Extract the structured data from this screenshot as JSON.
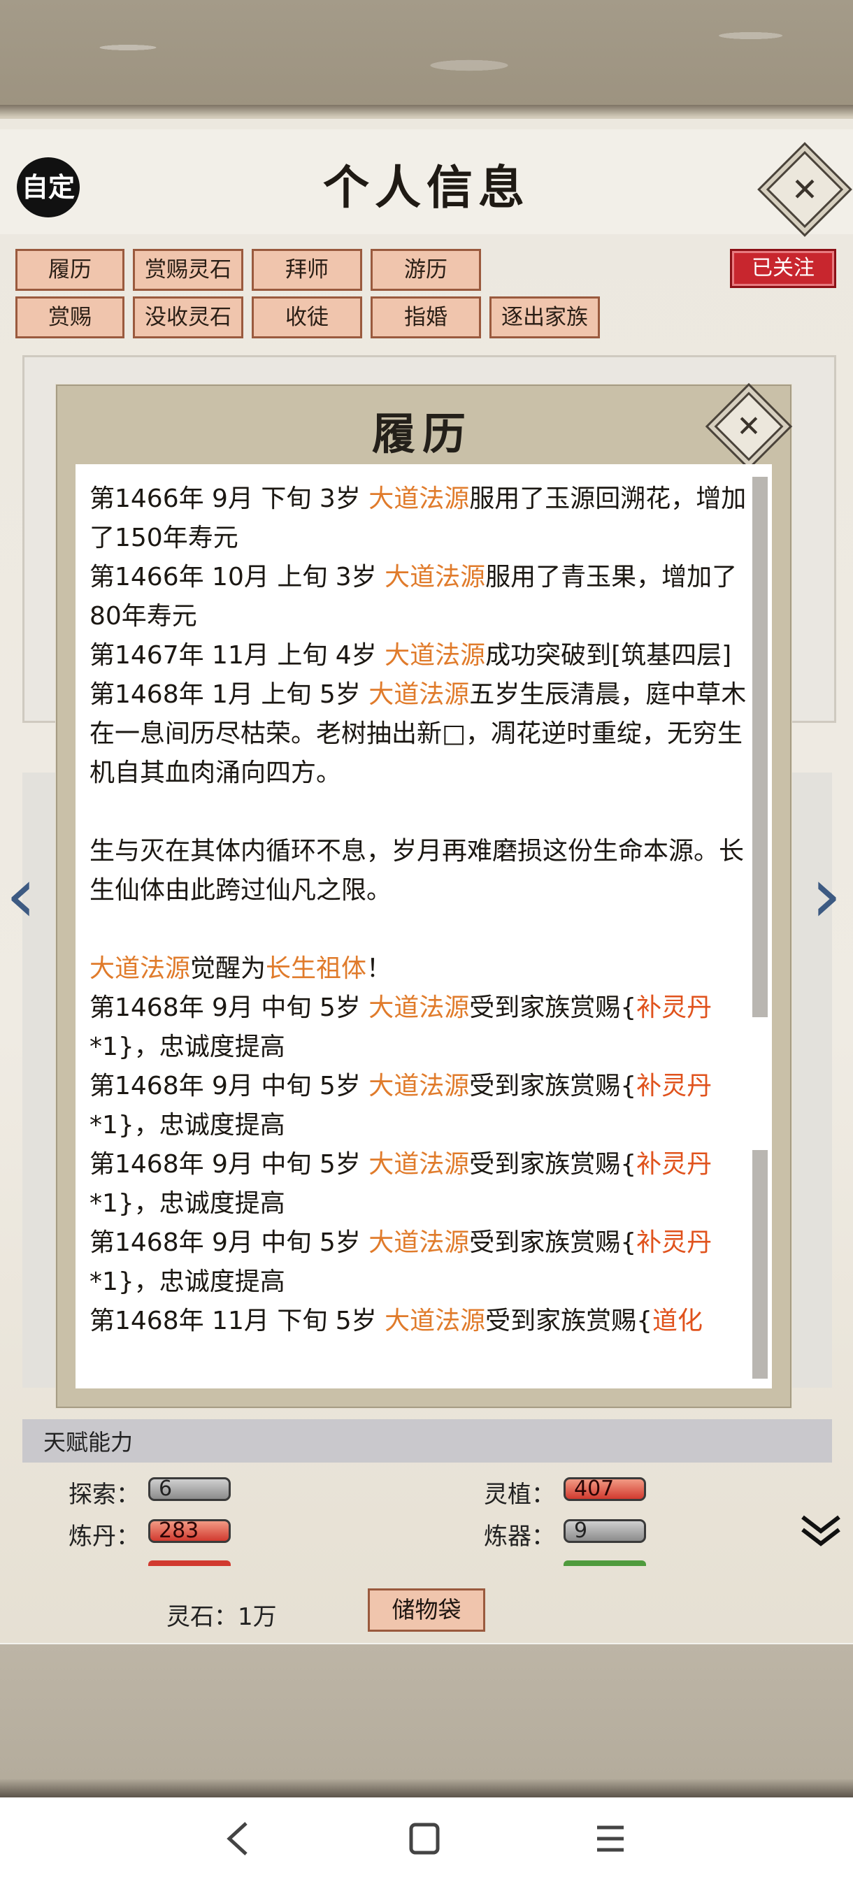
{
  "header": {
    "title": "个人信息",
    "custom_badge": "自定",
    "close_icon": "✕"
  },
  "actions": {
    "row1": [
      "履历",
      "赏赐灵石",
      "拜师",
      "游历"
    ],
    "row2": [
      "赏赐",
      "没收灵石",
      "收徒",
      "指婚",
      "逐出家族"
    ],
    "followed": "已关注"
  },
  "modal": {
    "title": "履历",
    "close_icon": "✕",
    "entries": [
      {
        "pre": "第1466年 9月 下旬 3岁 ",
        "name": "大道法源",
        "post": "服用了玉源回溯花，增加了150年寿元"
      },
      {
        "pre": "第1466年 10月 上旬 3岁 ",
        "name": "大道法源",
        "post": "服用了青玉果，增加了80年寿元"
      },
      {
        "pre": "第1467年 11月 上旬 4岁 ",
        "name": "大道法源",
        "post": "成功突破到[筑基四层]"
      },
      {
        "pre": "第1468年 1月 上旬 5岁 ",
        "name": "大道法源",
        "post": "五岁生辰清晨，庭中草木在一息间历尽枯荣。老树抽出新□，凋花逆时重绽，无穷生机自其血肉涌向四方。"
      },
      {
        "gap": true
      },
      {
        "plain": "生与灭在其体内循环不息，岁月再难磨损这份生命本源。长生仙体由此跨过仙凡之限。"
      },
      {
        "gap": true
      },
      {
        "name": "大道法源",
        "mid": "觉醒为",
        "name2": "长生祖体",
        "post": "！"
      },
      {
        "pre": "第1468年 9月 中旬 5岁 ",
        "name": "大道法源",
        "post": "受到家族赏赐{",
        "item": "补灵丹",
        "post2": "*1}，忠诚度提高"
      },
      {
        "pre": "第1468年 9月 中旬 5岁 ",
        "name": "大道法源",
        "post": "受到家族赏赐{",
        "item": "补灵丹",
        "post2": "*1}，忠诚度提高"
      },
      {
        "pre": "第1468年 9月 中旬 5岁 ",
        "name": "大道法源",
        "post": "受到家族赏赐{",
        "item": "补灵丹",
        "post2": "*1}，忠诚度提高"
      },
      {
        "pre": "第1468年 9月 中旬 5岁 ",
        "name": "大道法源",
        "post": "受到家族赏赐{",
        "item": "补灵丹",
        "post2": "*1}，忠诚度提高"
      },
      {
        "pre": "第1468年 11月 下旬 5岁 ",
        "name": "大道法源",
        "post": "受到家族赏赐{",
        "item": "道化",
        "post2": ""
      }
    ]
  },
  "talents": {
    "title": "天赋能力",
    "items": [
      {
        "label": "探索：",
        "value": "6",
        "style": "grey"
      },
      {
        "label": "灵植：",
        "value": "407",
        "style": "red"
      },
      {
        "label": "炼丹：",
        "value": "283",
        "style": "red"
      },
      {
        "label": "炼器：",
        "value": "9",
        "style": "grey"
      }
    ],
    "expand_icon": "double-chevron-down-icon"
  },
  "footer": {
    "spirit_stone": "灵石：1万",
    "storage_button": "储物袋"
  },
  "colors": {
    "accent_button": "#f0c5ad",
    "highlight_name": "#e07b2b",
    "highlight_item": "#e0521c",
    "followed_red": "#c8262e"
  }
}
